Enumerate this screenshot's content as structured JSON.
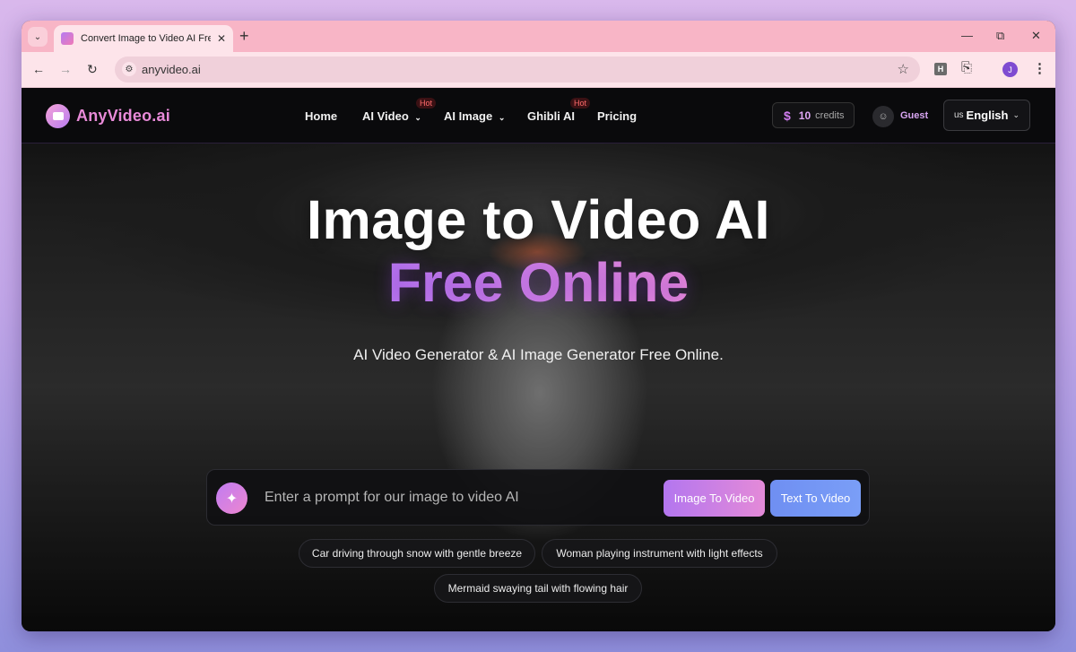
{
  "browser": {
    "tab_title": "Convert Image to Video AI Free",
    "url": "anyvideo.ai",
    "profile_initial": "J",
    "extension_label": "H"
  },
  "site": {
    "logo_text": "AnyVideo.ai",
    "nav": {
      "home": "Home",
      "ai_video": "AI Video",
      "ai_image": "AI Image",
      "ghibli": "Ghibli AI",
      "pricing": "Pricing",
      "hot_badge": "Hot"
    },
    "credits": {
      "symbol": "$",
      "count": "10",
      "label": "credits"
    },
    "user": {
      "name": "Guest"
    },
    "language": {
      "flag": "us",
      "name": "English"
    }
  },
  "hero": {
    "title_line1": "Image to Video AI",
    "title_line2": "Free Online",
    "subtitle": "AI Video Generator & AI Image Generator Free Online.",
    "prompt_placeholder": "Enter a prompt for our image to video AI",
    "btn_image_to_video": "Image To Video",
    "btn_text_to_video": "Text To Video",
    "suggestions": [
      "Car driving through snow with gentle breeze",
      "Woman playing instrument with light effects",
      "Mermaid swaying tail with flowing hair"
    ]
  },
  "colors": {
    "accent_pink": "#e48ee0",
    "accent_purple": "#b376ef",
    "accent_blue": "#6f8ff2",
    "tab_strip": "#f8b5c6"
  }
}
